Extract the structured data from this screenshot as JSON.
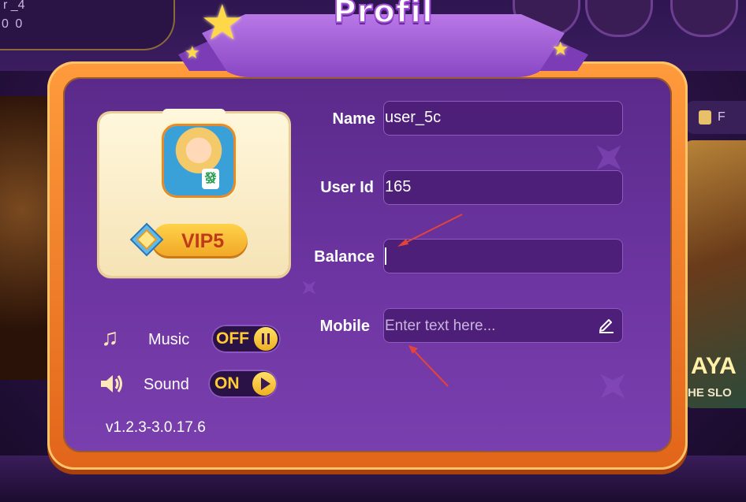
{
  "background": {
    "corner_text_1": "r _4",
    "corner_text_2": "0 0",
    "side_tab_label": "F",
    "side_banner_big": "AYA",
    "side_banner_small": "HE SLO"
  },
  "dialog": {
    "title": "Profil",
    "accent_color": "#f0841f",
    "panel_color": "#6a33a0"
  },
  "profile": {
    "vip_label": "VIP5",
    "avatar_tile_glyph": "發"
  },
  "settings": {
    "music": {
      "label": "Music",
      "state": "OFF"
    },
    "sound": {
      "label": "Sound",
      "state": "ON"
    }
  },
  "version": "v1.2.3-3.0.17.6",
  "form": {
    "name": {
      "label": "Name",
      "value": "user_5c"
    },
    "user_id": {
      "label": "User Id",
      "value": "165"
    },
    "balance": {
      "label": "Balance",
      "value": ""
    },
    "mobile": {
      "label": "Mobile",
      "value": "",
      "placeholder": "Enter text here..."
    }
  }
}
